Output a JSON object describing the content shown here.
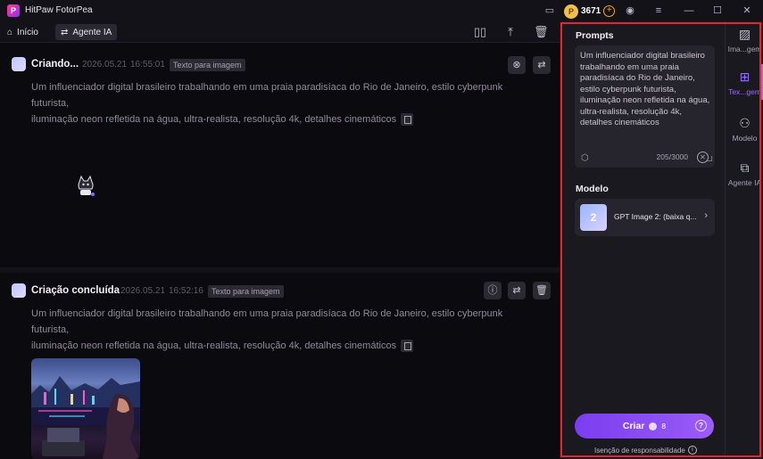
{
  "app": {
    "title": "HitPaw FotorPea",
    "logo_letter": "P",
    "credits": "3671",
    "window_controls": [
      "minimize",
      "maximize",
      "close"
    ]
  },
  "nav": {
    "home_label": "Início",
    "agent_label": "Agente IA"
  },
  "cards": [
    {
      "status": "Criando...",
      "date": "2026.05.21",
      "time": "16:55:01",
      "tag": "Texto para imagem",
      "prompt_line1": "Um influenciador digital brasileiro trabalhando em uma praia paradisíaca do Rio de Janeiro, estilo cyberpunk futurista,",
      "prompt_line2": "iluminação neon refletida na água, ultra-realista, resolução 4k, detalhes cinemáticos"
    },
    {
      "status": "Criação concluída",
      "date": "2026.05.21",
      "time": "16:52:16",
      "tag": "Texto para imagem",
      "prompt_line1": "Um influenciador digital brasileiro trabalhando em uma praia paradisíaca do Rio de Janeiro, estilo cyberpunk futurista,",
      "prompt_line2": "iluminação neon refletida na água, ultra-realista, resolução 4k, detalhes cinemáticos"
    }
  ],
  "panel": {
    "prompts_heading": "Prompts",
    "prompt_value": "Um influenciador digital brasileiro trabalhando em uma praia paradisíaca do Rio de Janeiro, estilo cyberpunk futurista, iluminação neon refletida na água, ultra-realista, resolução 4k, detalhes cinemáticos",
    "char_count": "205/3000",
    "model_heading": "Modelo",
    "model_thumb_label": "2",
    "model_name": "GPT Image 2: (baixa q...",
    "create_label": "Criar",
    "create_cost": "8",
    "disclaimer": "Isenção de responsabilidade"
  },
  "rail": {
    "items": [
      {
        "label": "Ima...gem",
        "icon": "image-icon"
      },
      {
        "label": "Tex...gem",
        "icon": "text-to-image-icon"
      },
      {
        "label": "Modelo",
        "icon": "model-grid-icon"
      },
      {
        "label": "Agente IA",
        "icon": "agent-icon"
      }
    ]
  },
  "colors": {
    "accent": "#9b6bff",
    "highlight_outline": "#e5262d",
    "coin": "#f1c04b"
  }
}
